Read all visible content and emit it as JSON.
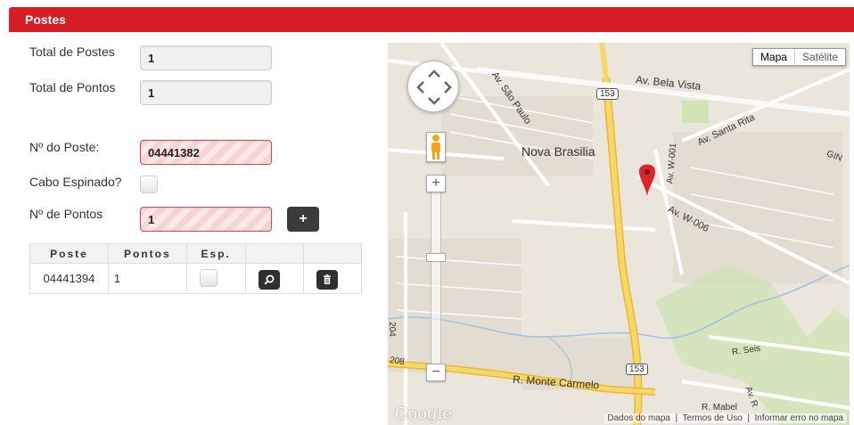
{
  "header": {
    "title": "Postes"
  },
  "form": {
    "total_postes_label": "Total de Postes",
    "total_postes_value": "1",
    "total_pontos_label": "Total de Pontos",
    "total_pontos_value": "1",
    "numero_poste_label": "Nº do Poste:",
    "numero_poste_value": "04441382",
    "cabo_espinado_label": "Cabo Espinado?",
    "numero_pontos_label": "Nº de Pontos",
    "numero_pontos_value": "1",
    "add_button_label": "+"
  },
  "table": {
    "headers": [
      "Poste",
      "Pontos",
      "Esp.",
      "",
      ""
    ],
    "rows": [
      {
        "poste": "04441394",
        "pontos": "1"
      }
    ]
  },
  "map": {
    "type_buttons": {
      "map": "Mapa",
      "satellite": "Satélite"
    },
    "labels": {
      "av_bela_vista": "Av. Bela Vista",
      "av_sao_paulo": "Av. São Paulo",
      "nova_brasilia": "Nova Brasilia",
      "av_santa_rita": "Av. Santa Rita",
      "av_w001": "Av. W-001",
      "av_w006": "Av. W-006",
      "gin": "GIN",
      "route_153_top": "153",
      "route_153_bottom": "153",
      "r_monte_carmelo": "R. Monte Carmelo",
      "r_seis": "R. Seis",
      "r_mabel": "R. Mabel",
      "av_r": "Av. R",
      "num_208": "208",
      "num_204": "204"
    },
    "footer": {
      "dados": "Dados do mapa",
      "termos": "Termos de Uso",
      "informar": "Informar erro no mapa"
    },
    "logo": "Google",
    "zoom_in": "+",
    "zoom_out": "−"
  },
  "colors": {
    "header_bg": "#d91d25",
    "road_major": "#f6d161",
    "marker": "#d8262c"
  }
}
